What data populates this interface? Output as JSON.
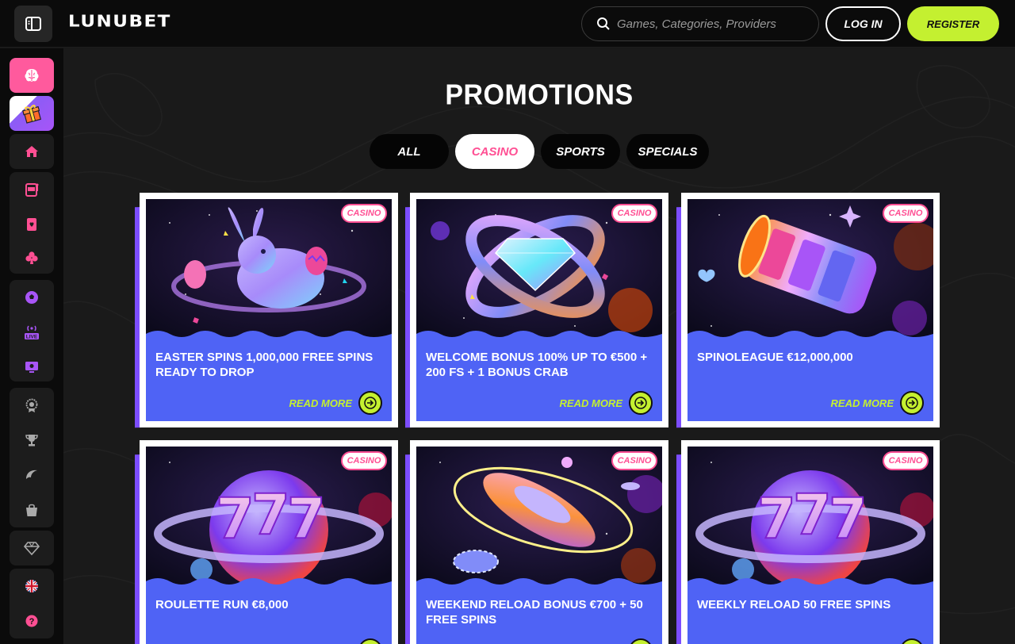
{
  "header": {
    "logo": "LUNUBET",
    "search_placeholder": "Games, Categories, Providers",
    "login_label": "LOG IN",
    "register_label": "REGISTER"
  },
  "sidebar": {
    "items": [
      {
        "name": "brain-icon"
      },
      {
        "name": "gift-icon"
      },
      {
        "name": "home-icon"
      },
      {
        "name": "slot-machine-icon"
      },
      {
        "name": "cards-icon"
      },
      {
        "name": "club-icon"
      },
      {
        "name": "soccer-ball-icon"
      },
      {
        "name": "live-icon",
        "label": "LIVE"
      },
      {
        "name": "esports-monitor-icon"
      },
      {
        "name": "award-icon"
      },
      {
        "name": "trophy-icon"
      },
      {
        "name": "swoosh-icon"
      },
      {
        "name": "shopping-bag-icon"
      },
      {
        "name": "diamond-icon"
      },
      {
        "name": "uk-flag-icon"
      },
      {
        "name": "help-icon",
        "label": "?"
      }
    ]
  },
  "main": {
    "title": "PROMOTIONS",
    "tabs": [
      {
        "label": "ALL",
        "active": false
      },
      {
        "label": "CASINO",
        "active": true
      },
      {
        "label": "SPORTS",
        "active": false
      },
      {
        "label": "SPECIALS",
        "active": false
      }
    ],
    "read_more_label": "READ MORE",
    "cards": [
      {
        "badge": "CASINO",
        "title": "EASTER SPINS 1,000,000 FREE SPINS READY TO DROP",
        "image": "easter-bunny"
      },
      {
        "badge": "CASINO",
        "title": "WELCOME BONUS 100% UP TO €500 + 200 FS + 1 BONUS CRAB",
        "image": "diamond-rings"
      },
      {
        "badge": "CASINO",
        "title": "SPINOLEAGUE €12,000,000",
        "image": "slot-reels"
      },
      {
        "badge": "CASINO",
        "title": "ROULETTE RUN €8,000",
        "image": "sevens-planet"
      },
      {
        "badge": "CASINO",
        "title": "WEEKEND RELOAD BONUS €700 + 50 FREE SPINS",
        "image": "roulette-saucer"
      },
      {
        "badge": "CASINO",
        "title": "WEEKLY RELOAD 50 FREE SPINS",
        "image": "sevens-planet"
      }
    ]
  },
  "colors": {
    "accent_pink": "#ff4f93",
    "accent_lime": "#c4f030",
    "card_blue": "#4f63f5",
    "card_shadow_purple": "#7c4dff"
  }
}
